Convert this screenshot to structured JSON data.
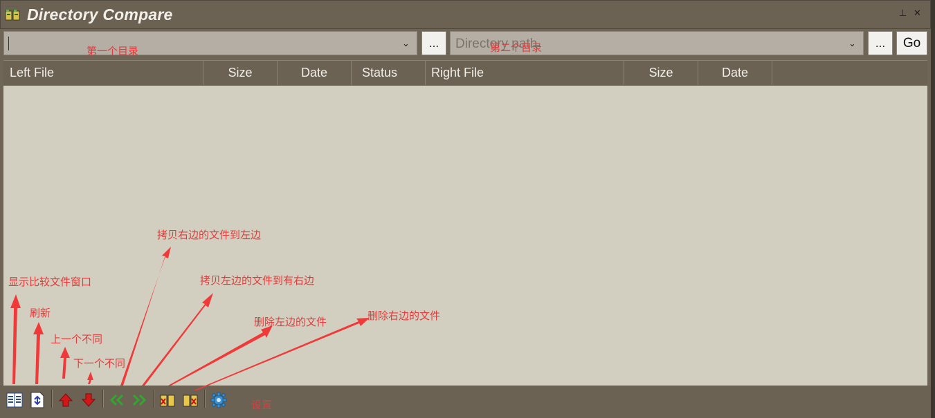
{
  "window": {
    "title": "Directory Compare",
    "pin_glyph": "⊥",
    "close_glyph": "✕"
  },
  "paths": {
    "left_value": "",
    "left_placeholder": "",
    "right_placeholder": "Directory path",
    "browse_label": "...",
    "go_label": "Go"
  },
  "table": {
    "columns": [
      "Left File",
      "Size",
      "Date",
      "Status",
      "Right File",
      "Size",
      "Date"
    ]
  },
  "toolbar": {
    "buttons": [
      {
        "icon": "compare-window-icon"
      },
      {
        "icon": "refresh-icon"
      },
      {
        "icon": "previous-diff-icon"
      },
      {
        "icon": "next-diff-icon"
      },
      {
        "icon": "copy-right-to-left-icon"
      },
      {
        "icon": "copy-left-to-right-icon"
      },
      {
        "icon": "delete-left-file-icon"
      },
      {
        "icon": "delete-right-file-icon"
      },
      {
        "icon": "settings-icon"
      }
    ]
  },
  "annotations": {
    "first_dir": "第一个目录",
    "second_dir": "第二个目录",
    "show_compare": "显示比较文件窗口",
    "refresh": "刷新",
    "prev_diff": "上一个不同",
    "next_diff": "下一个不同",
    "copy_right_to_left": "拷贝右边的文件到左边",
    "copy_left_to_right": "拷贝左边的文件到有右边",
    "delete_left": "删除左边的文件",
    "delete_right": "删除右边的文件",
    "settings": "设置"
  },
  "colors": {
    "chrome": "#6b6254",
    "list_background": "#d3cfc0",
    "annotation": "#e23b3b",
    "arrow_up": "#d01818",
    "arrow_green": "#2fa82f"
  }
}
